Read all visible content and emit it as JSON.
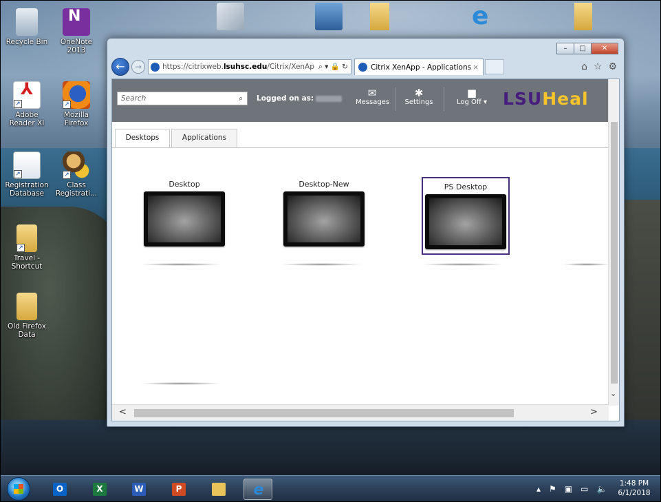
{
  "desktop": {
    "icons": [
      {
        "label": "Recycle Bin"
      },
      {
        "label": "OneNote 2013"
      },
      {
        "label": "Adobe Reader XI"
      },
      {
        "label": "Mozilla Firefox"
      },
      {
        "label": "Registration Database"
      },
      {
        "label": "Class Registrati..."
      },
      {
        "label": "Travel - Shortcut"
      },
      {
        "label": "Old Firefox Data"
      }
    ]
  },
  "browser": {
    "address": {
      "scheme": "https://",
      "host_prefix": "citrixweb.",
      "host_bold": "lsuhsc.edu",
      "path": "/Citrix/XenAp",
      "controls": "⌕ ▾ 🔒 ↻"
    },
    "tab": {
      "title": "Citrix XenApp - Applications",
      "close": "×"
    },
    "caption": {
      "minimize": "–",
      "maximize": "□",
      "close": "✕"
    },
    "toolbar_icons": {
      "home": "⌂",
      "favorites": "☆",
      "tools": "⚙"
    }
  },
  "receiver": {
    "search_placeholder": "Search",
    "search_icon": "⌕",
    "logged_on_label": "Logged on as:",
    "buttons": {
      "messages": "Messages",
      "settings": "Settings",
      "logoff": "Log Off ▾"
    },
    "brand_lsu": "LSU",
    "brand_health": "Heal",
    "tabs": {
      "desktops": "Desktops",
      "applications": "Applications"
    },
    "desktops": [
      {
        "label": "Desktop"
      },
      {
        "label": "Desktop-New"
      },
      {
        "label": "PS Desktop",
        "selected": true
      }
    ]
  },
  "scrollbars": {
    "up": "^",
    "down": "⌄",
    "left": "<",
    "right": ">"
  },
  "taskbar": {
    "apps": [
      {
        "name": "Outlook",
        "letter": "O",
        "color": "#0a64c8"
      },
      {
        "name": "Excel",
        "letter": "X",
        "color": "#1d7a3e"
      },
      {
        "name": "Word",
        "letter": "W",
        "color": "#2b5cb8"
      },
      {
        "name": "PowerPoint",
        "letter": "P",
        "color": "#d04a24"
      },
      {
        "name": "File Explorer",
        "letter": "",
        "color": "#e8c35a"
      },
      {
        "name": "Internet Explorer",
        "letter": "e",
        "color": "#2b8ad8"
      }
    ],
    "tray": {
      "up": "▴",
      "flag": "⚑",
      "network": "▣",
      "display": "▭",
      "volume": "🔈"
    },
    "time": "1:48 PM",
    "date": "6/1/2018"
  }
}
